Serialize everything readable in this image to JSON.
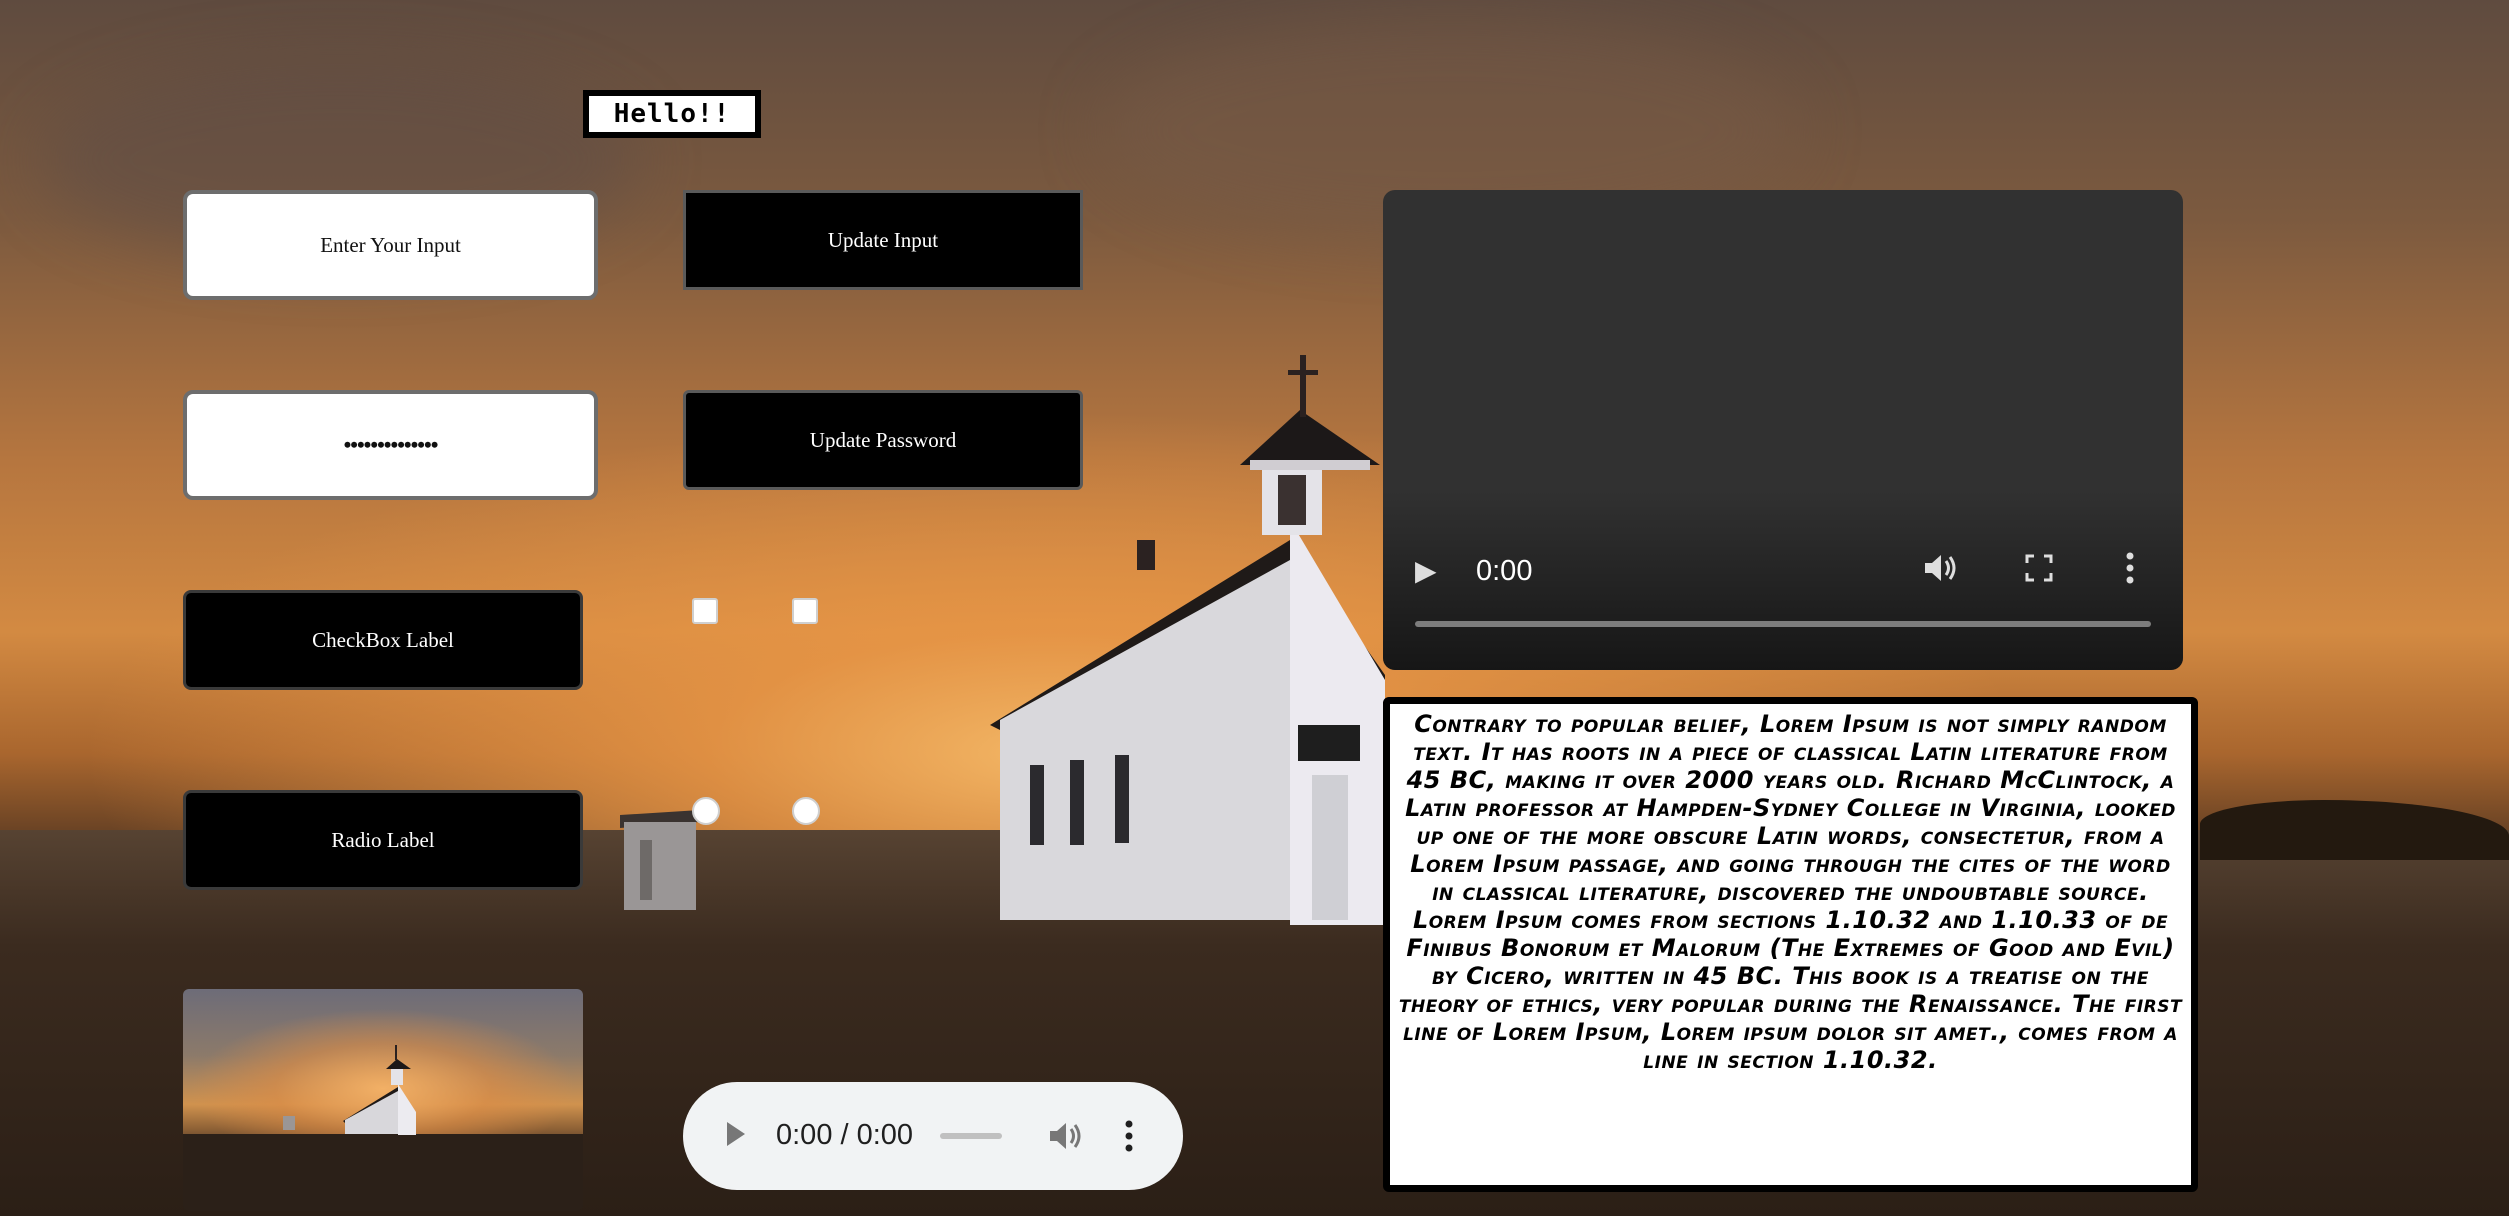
{
  "greeting": "Hello!!",
  "text_input": {
    "placeholder": "Enter Your Input",
    "value": ""
  },
  "password_input": {
    "value": "••••••••••••••"
  },
  "buttons": {
    "update_input": "Update Input",
    "update_password": "Update Password"
  },
  "checkbox": {
    "label": "CheckBox Label",
    "options_checked": [
      false,
      false
    ]
  },
  "radio": {
    "label": "Radio Label",
    "options_selected": [
      false,
      false
    ]
  },
  "video_player": {
    "time": "0:00"
  },
  "audio_player": {
    "time": "0:00 / 0:00"
  },
  "paragraph": "Contrary to popular belief, Lorem Ipsum is not simply random text. It has roots in a piece of classical Latin literature from 45 BC, making it over 2000 years old. Richard McClintock, a Latin professor at Hampden-Sydney College in Virginia, looked up one of the more obscure Latin words, consectetur, from a Lorem Ipsum passage, and going through the cites of the word in classical literature, discovered the undoubtable source. Lorem Ipsum comes from sections 1.10.32 and 1.10.33 of de Finibus Bonorum et Malorum (The Extremes of Good and Evil) by Cicero, written in 45 BC. This book is a treatise on the theory of ethics, very popular during the Renaissance. The first line of Lorem Ipsum, Lorem ipsum dolor sit amet., comes from a line in section 1.10.32.",
  "icons": {
    "video_play": "play-icon",
    "video_volume": "volume-icon",
    "video_fullscreen": "fullscreen-icon",
    "video_menu": "more-vertical-icon",
    "audio_play": "play-icon",
    "audio_volume": "volume-icon",
    "audio_menu": "more-vertical-icon"
  }
}
